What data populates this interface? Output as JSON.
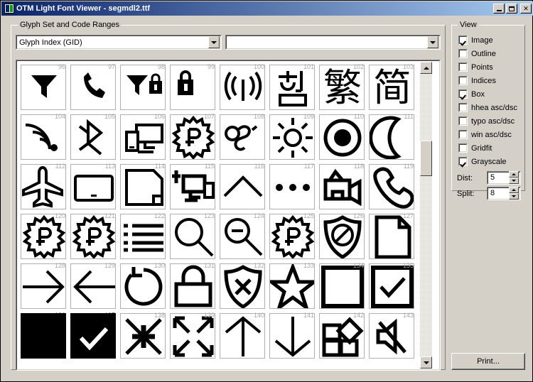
{
  "window": {
    "title": "OTM Light Font Viewer - segmdl2.ttf",
    "icon": "app-icon",
    "minimize_label": "_",
    "maximize_label": "□",
    "close_label": "✕"
  },
  "glyph_group": {
    "legend": "Glyph Set and Code Ranges",
    "set_combo": {
      "value": "Glyph Index (GID)",
      "placeholder": ""
    },
    "range_combo": {
      "value": "",
      "placeholder": ""
    }
  },
  "view_panel": {
    "legend": "View",
    "checkboxes": [
      {
        "label": "Image",
        "checked": true
      },
      {
        "label": "Outline",
        "checked": false
      },
      {
        "label": "Points",
        "checked": false
      },
      {
        "label": "Indices",
        "checked": false
      },
      {
        "label": "Box",
        "checked": true
      },
      {
        "label": "hhea asc/dsc",
        "checked": false
      },
      {
        "label": "typo asc/dsc",
        "checked": false
      },
      {
        "label": "win asc/dsc",
        "checked": false
      },
      {
        "label": "Gridfit",
        "checked": false
      },
      {
        "label": "Grayscale",
        "checked": true
      }
    ],
    "dist": {
      "label": "Dist:",
      "value": "5"
    },
    "split": {
      "label": "Split:",
      "value": "8"
    }
  },
  "print_button": {
    "label": "Print..."
  },
  "scrollbar": {
    "up_arrow": "scroll-up-arrow",
    "down_arrow": "scroll-down-arrow",
    "thumb_position_percent": 27
  },
  "glyph_grid": {
    "columns": 8,
    "rows": 6,
    "first_index": 96,
    "last_index": 143,
    "cells": [
      {
        "index": "96",
        "icon": "signal-filter-icon",
        "inverted": false
      },
      {
        "index": "97",
        "icon": "phone-handset-icon",
        "inverted": false
      },
      {
        "index": "98",
        "icon": "signal-lock-icon",
        "inverted": false
      },
      {
        "index": "99",
        "icon": "lock-small-icon",
        "inverted": false
      },
      {
        "index": "100",
        "icon": "broadcast-signal-icon",
        "inverted": false
      },
      {
        "index": "101",
        "icon": "hangul-character-icon",
        "inverted": false
      },
      {
        "index": "102",
        "icon": "traditional-chinese-icon",
        "inverted": false
      },
      {
        "index": "103",
        "icon": "simplified-chinese-icon",
        "inverted": false
      },
      {
        "index": "104",
        "icon": "wifi-signal-icon",
        "inverted": false
      },
      {
        "index": "105",
        "icon": "bluetooth-icon",
        "inverted": false
      },
      {
        "index": "106",
        "icon": "connected-devices-icon",
        "inverted": false
      },
      {
        "index": "107",
        "icon": "ruble-starburst-icon",
        "inverted": false
      },
      {
        "index": "108",
        "icon": "infinity-loop-icon",
        "inverted": false
      },
      {
        "index": "109",
        "icon": "brightness-sun-icon",
        "inverted": false
      },
      {
        "index": "110",
        "icon": "radio-button-icon",
        "inverted": false
      },
      {
        "index": "111",
        "icon": "crescent-moon-icon",
        "inverted": false
      },
      {
        "index": "112",
        "icon": "airplane-icon",
        "inverted": false
      },
      {
        "index": "113",
        "icon": "tablet-icon",
        "inverted": false
      },
      {
        "index": "114",
        "icon": "page-fold-icon",
        "inverted": false
      },
      {
        "index": "115",
        "icon": "connect-device-plus-icon",
        "inverted": false
      },
      {
        "index": "116",
        "icon": "chevron-up-icon",
        "inverted": false
      },
      {
        "index": "117",
        "icon": "ellipsis-icon",
        "inverted": false
      },
      {
        "index": "118",
        "icon": "video-camera-icon",
        "inverted": false
      },
      {
        "index": "119",
        "icon": "phone-large-icon",
        "inverted": false
      },
      {
        "index": "120",
        "icon": "ruble-starburst-icon",
        "inverted": false
      },
      {
        "index": "121",
        "icon": "ruble-starburst-icon",
        "inverted": false
      },
      {
        "index": "122",
        "icon": "list-lines-icon",
        "inverted": false
      },
      {
        "index": "123",
        "icon": "magnifier-icon",
        "inverted": false
      },
      {
        "index": "124",
        "icon": "zoom-out-icon",
        "inverted": false
      },
      {
        "index": "125",
        "icon": "ruble-starburst-icon",
        "inverted": false
      },
      {
        "index": "126",
        "icon": "shield-block-icon",
        "inverted": false
      },
      {
        "index": "127",
        "icon": "document-page-icon",
        "inverted": false
      },
      {
        "index": "128",
        "icon": "arrow-right-icon",
        "inverted": false
      },
      {
        "index": "129",
        "icon": "arrow-left-icon",
        "inverted": false
      },
      {
        "index": "130",
        "icon": "refresh-icon",
        "inverted": false
      },
      {
        "index": "131",
        "icon": "padlock-icon",
        "inverted": false
      },
      {
        "index": "132",
        "icon": "shield-x-icon",
        "inverted": false
      },
      {
        "index": "133",
        "icon": "star-outline-icon",
        "inverted": false
      },
      {
        "index": "134",
        "icon": "checkbox-empty-icon",
        "inverted": false
      },
      {
        "index": "135",
        "icon": "checkbox-checked-icon",
        "inverted": false
      },
      {
        "index": "136",
        "icon": "filled-square-icon",
        "inverted": true
      },
      {
        "index": "137",
        "icon": "filled-check-icon",
        "inverted": true
      },
      {
        "index": "138",
        "icon": "collapse-arrows-icon",
        "inverted": false
      },
      {
        "index": "139",
        "icon": "expand-arrows-icon",
        "inverted": false
      },
      {
        "index": "140",
        "icon": "arrow-up-icon",
        "inverted": false
      },
      {
        "index": "141",
        "icon": "arrow-down-icon",
        "inverted": false
      },
      {
        "index": "142",
        "icon": "tiles-icon",
        "inverted": false
      },
      {
        "index": "143",
        "icon": "mute-speaker-icon",
        "inverted": false
      }
    ]
  }
}
